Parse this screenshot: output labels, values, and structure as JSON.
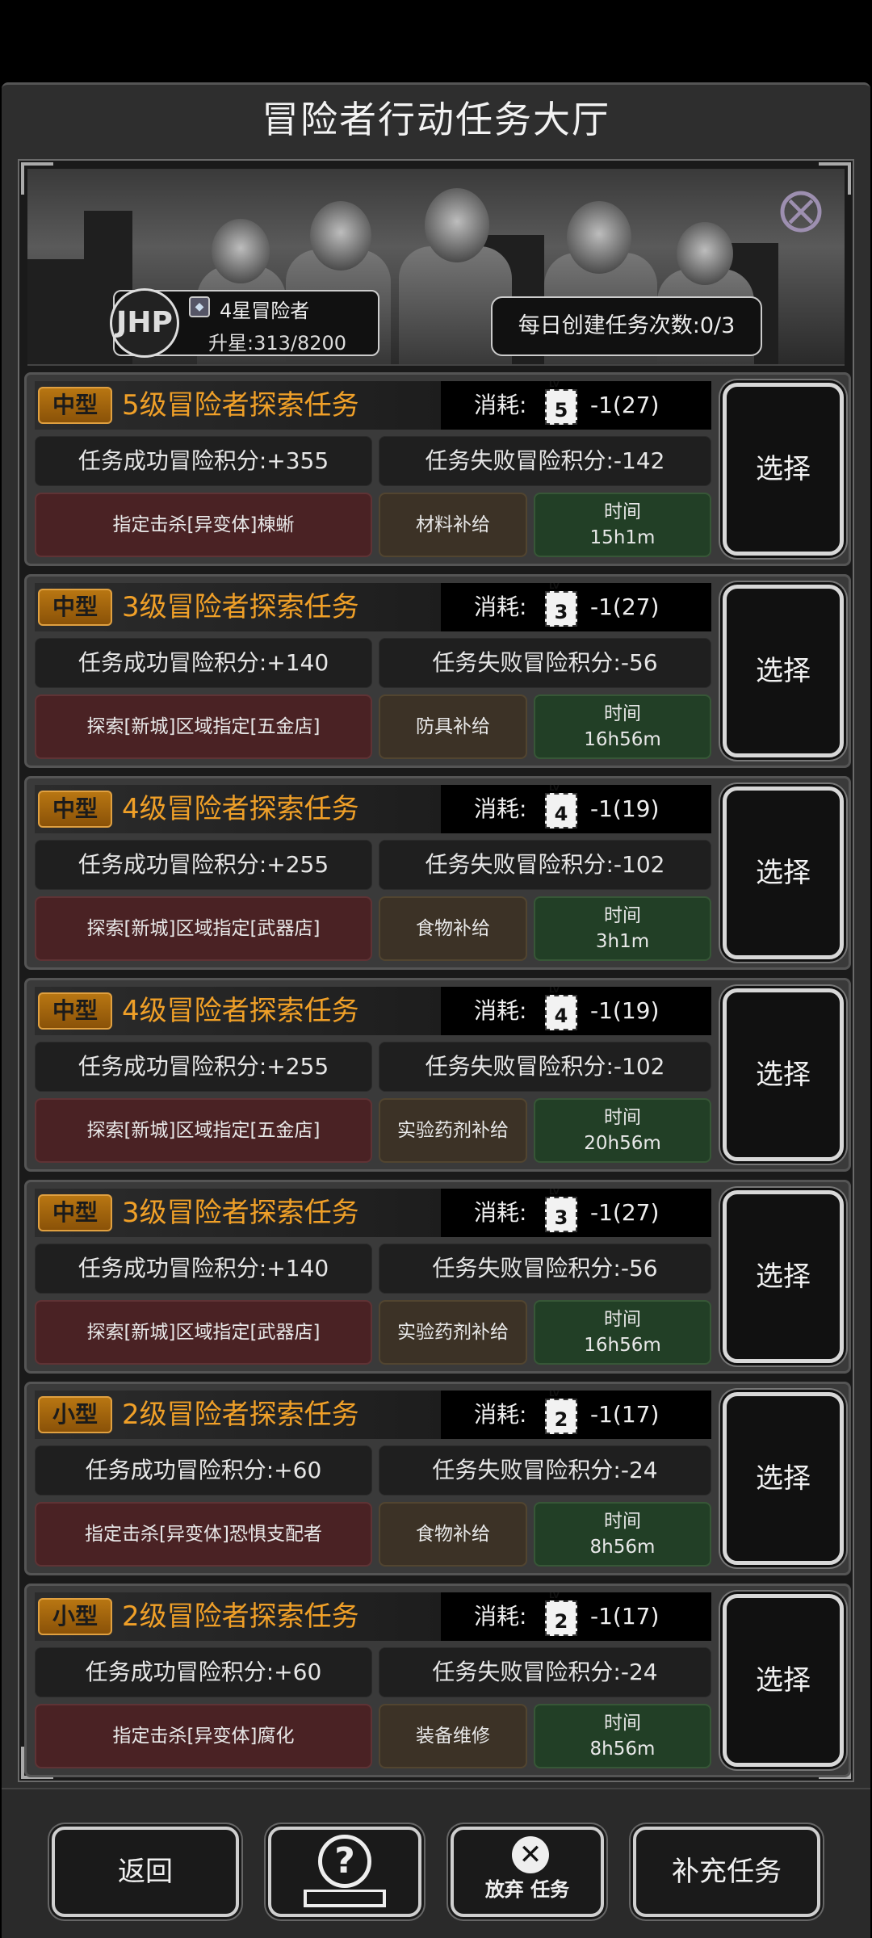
{
  "header": {
    "title": "冒险者行动任务大厅"
  },
  "rank": {
    "avatar_text": "JHP",
    "gem": "◆",
    "name": "4星冒险者",
    "progress": "升星:313/8200"
  },
  "daily": {
    "label": "每日创建任务次数:0/3"
  },
  "cost_label": "消耗:",
  "select_label": "选择",
  "time_label": "时间",
  "tasks": [
    {
      "size": "中型",
      "name": "5级冒险者探索任务",
      "lv": "5",
      "cost": "-1(27)",
      "success": "任务成功冒险积分:+355",
      "fail": "任务失败冒险积分:-142",
      "target": "指定击杀[异变体]棟蜥",
      "supply": "材料补给",
      "time": "15h1m"
    },
    {
      "size": "中型",
      "name": "3级冒险者探索任务",
      "lv": "3",
      "cost": "-1(27)",
      "success": "任务成功冒险积分:+140",
      "fail": "任务失败冒险积分:-56",
      "target": "探索[新城]区域指定[五金店]",
      "supply": "防具补给",
      "time": "16h56m"
    },
    {
      "size": "中型",
      "name": "4级冒险者探索任务",
      "lv": "4",
      "cost": "-1(19)",
      "success": "任务成功冒险积分:+255",
      "fail": "任务失败冒险积分:-102",
      "target": "探索[新城]区域指定[武器店]",
      "supply": "食物补给",
      "time": "3h1m"
    },
    {
      "size": "中型",
      "name": "4级冒险者探索任务",
      "lv": "4",
      "cost": "-1(19)",
      "success": "任务成功冒险积分:+255",
      "fail": "任务失败冒险积分:-102",
      "target": "探索[新城]区域指定[五金店]",
      "supply": "实验药剂补给",
      "time": "20h56m"
    },
    {
      "size": "中型",
      "name": "3级冒险者探索任务",
      "lv": "3",
      "cost": "-1(27)",
      "success": "任务成功冒险积分:+140",
      "fail": "任务失败冒险积分:-56",
      "target": "探索[新城]区域指定[武器店]",
      "supply": "实验药剂补给",
      "time": "16h56m"
    },
    {
      "size": "小型",
      "name": "2级冒险者探索任务",
      "lv": "2",
      "cost": "-1(17)",
      "success": "任务成功冒险积分:+60",
      "fail": "任务失败冒险积分:-24",
      "target": "指定击杀[异变体]恐惧支配者",
      "supply": "食物补给",
      "time": "8h56m"
    },
    {
      "size": "小型",
      "name": "2级冒险者探索任务",
      "lv": "2",
      "cost": "-1(17)",
      "success": "任务成功冒险积分:+60",
      "fail": "任务失败冒险积分:-24",
      "target": "指定击杀[异变体]腐化",
      "supply": "装备维修",
      "time": "8h56m"
    }
  ],
  "bottom": {
    "back": "返回",
    "help_icon": "?",
    "abandon_icon": "✕",
    "abandon_label": "放弃 任务",
    "refill": "补充任务"
  },
  "colors": {
    "accent_orange": "#f0a028",
    "success_bg": "#1f1f1f",
    "target_bg": "#4a2224",
    "supply_bg": "#3c3226",
    "time_bg": "#223f26"
  }
}
